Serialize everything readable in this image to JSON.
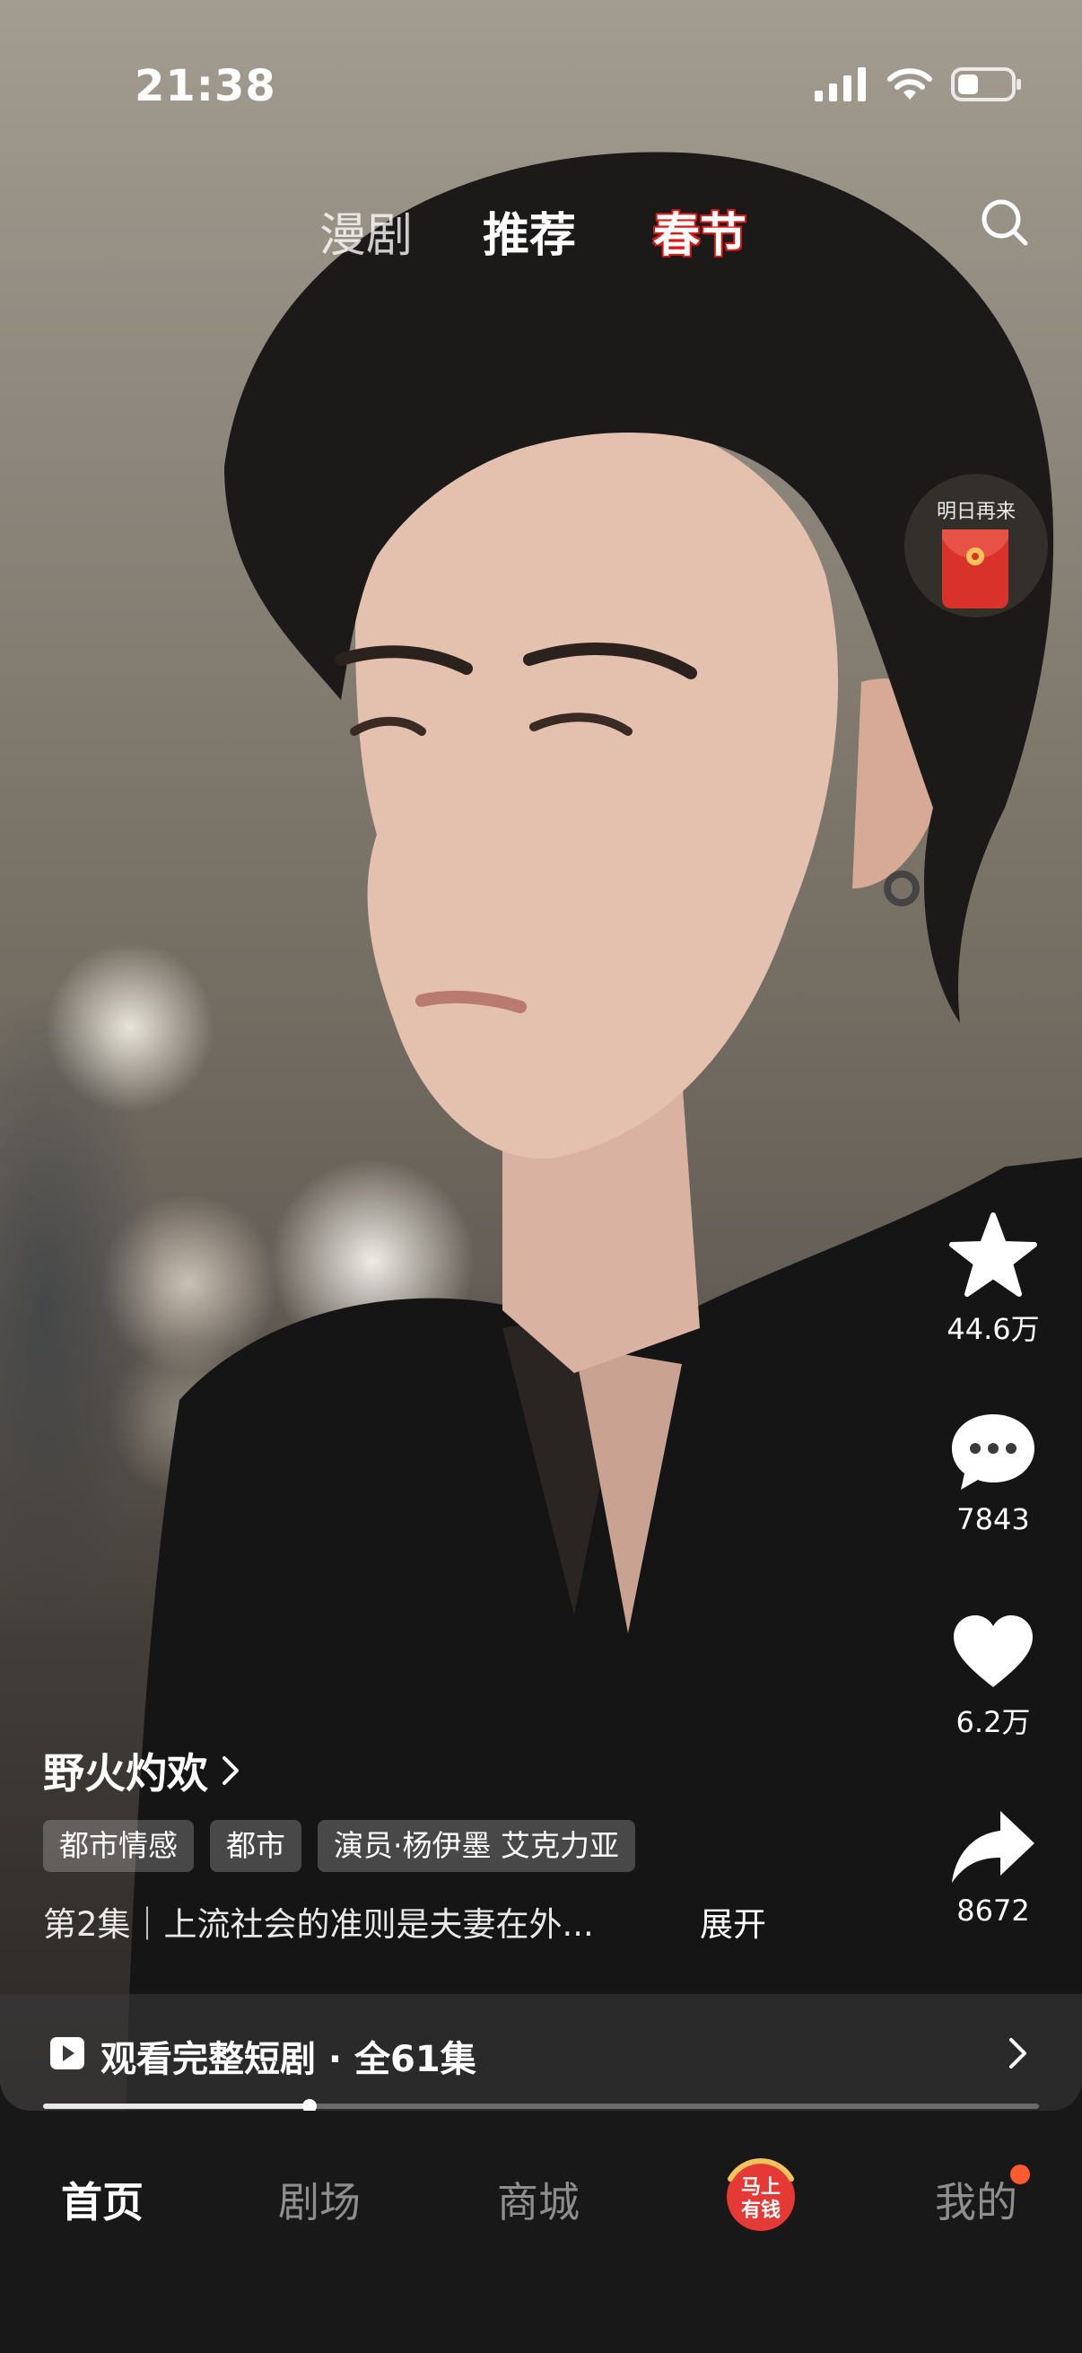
{
  "status_bar": {
    "time": "21:38"
  },
  "top_tabs": [
    {
      "label": "漫剧"
    },
    {
      "label": "推荐"
    },
    {
      "label": "春节"
    }
  ],
  "envelope": {
    "label": "明日再来"
  },
  "actions": {
    "favorite_count": "44.6万",
    "comment_count": "7843",
    "like_count": "6.2万",
    "share_count": "8672"
  },
  "drama": {
    "title": "野火灼欢",
    "tags": [
      "都市情感",
      "都市",
      "演员·杨伊墨 艾克力亚"
    ],
    "description": "第2集｜上流社会的准则是夫妻在外...",
    "expand_label": "展开"
  },
  "watch_full": {
    "label": "观看完整短剧 · 全61集"
  },
  "progress": {
    "fraction": 0.268
  },
  "bottom_nav": {
    "home": "首页",
    "theater": "剧场",
    "mall": "商城",
    "promo": "马上有钱",
    "mine": "我的"
  },
  "colors": {
    "accent_red": "#e53935",
    "notification_dot": "#ff5b2e",
    "nav_active": "#ffffff",
    "nav_inactive": "#8e8e8e"
  }
}
